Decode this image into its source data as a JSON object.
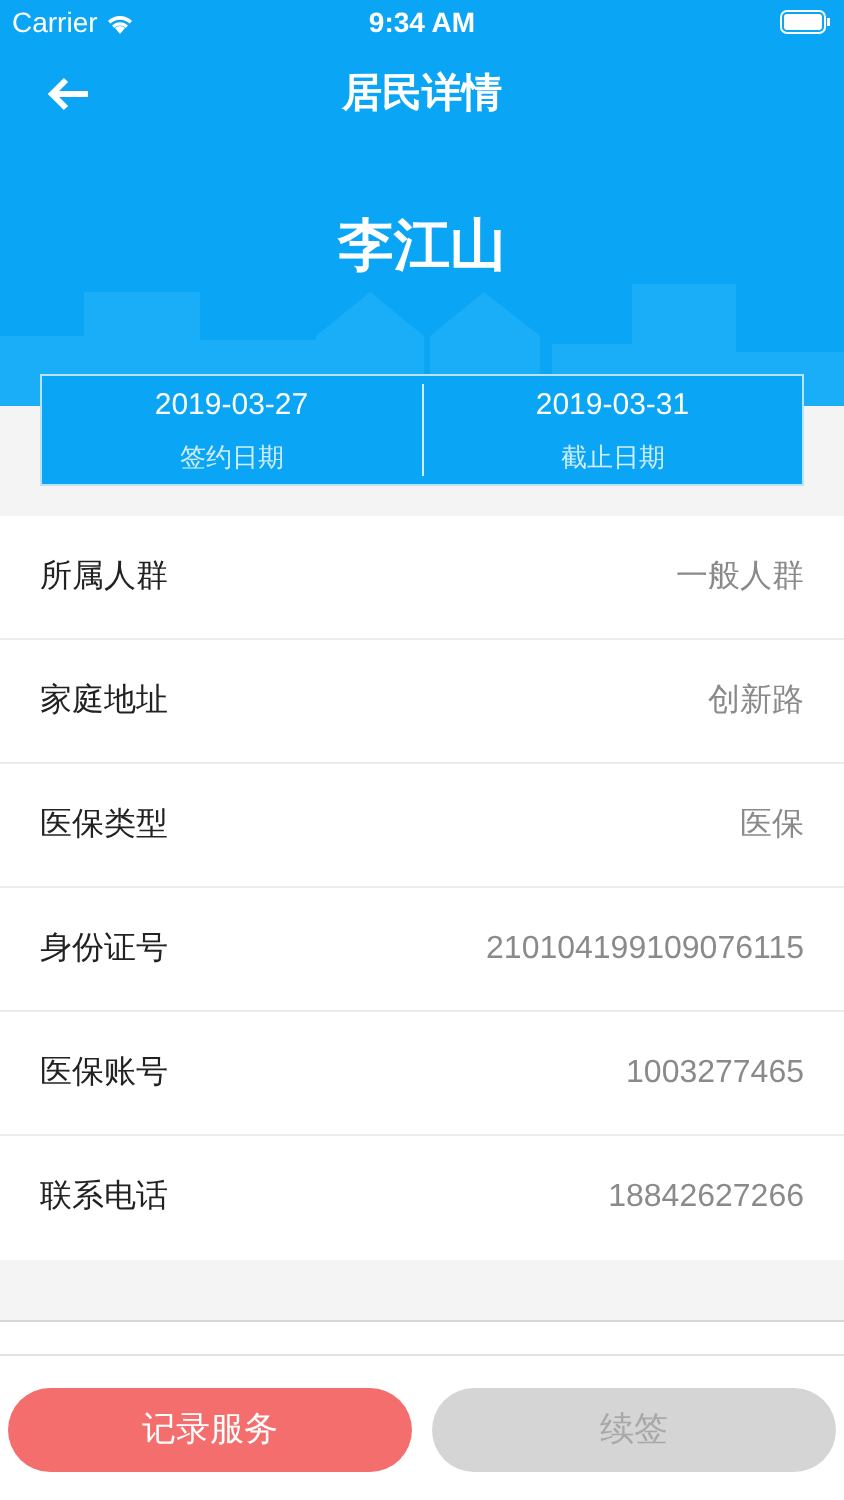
{
  "status_bar": {
    "carrier": "Carrier",
    "time": "9:34 AM"
  },
  "nav": {
    "title": "居民详情"
  },
  "resident": {
    "name": "李江山"
  },
  "dates": [
    {
      "value": "2019-03-27",
      "label": "签约日期"
    },
    {
      "value": "2019-03-31",
      "label": "截止日期"
    }
  ],
  "fields": [
    {
      "label": "所属人群",
      "value": "一般人群"
    },
    {
      "label": "家庭地址",
      "value": "创新路"
    },
    {
      "label": "医保类型",
      "value": "医保"
    },
    {
      "label": "身份证号",
      "value": "210104199109076115"
    },
    {
      "label": "医保账号",
      "value": "1003277465"
    },
    {
      "label": "联系电话",
      "value": "18842627266"
    }
  ],
  "buttons": [
    {
      "label": "记录服务",
      "disabled": false
    },
    {
      "label": "续签",
      "disabled": true
    }
  ]
}
